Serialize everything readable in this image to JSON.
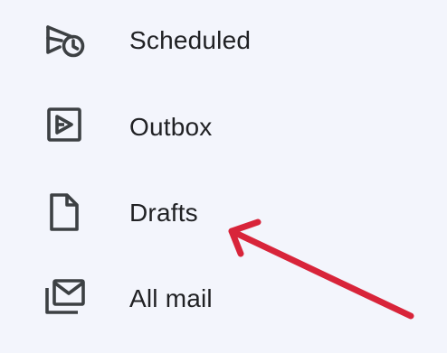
{
  "nav": {
    "items": [
      {
        "label": "Scheduled",
        "icon": "scheduled-send-icon"
      },
      {
        "label": "Outbox",
        "icon": "outbox-icon"
      },
      {
        "label": "Drafts",
        "icon": "draft-icon"
      },
      {
        "label": "All mail",
        "icon": "all-mail-icon"
      }
    ]
  },
  "colors": {
    "background": "#f3f5fc",
    "text": "#202124",
    "icon": "#3c4043",
    "annotation_arrow": "#d8243a"
  }
}
